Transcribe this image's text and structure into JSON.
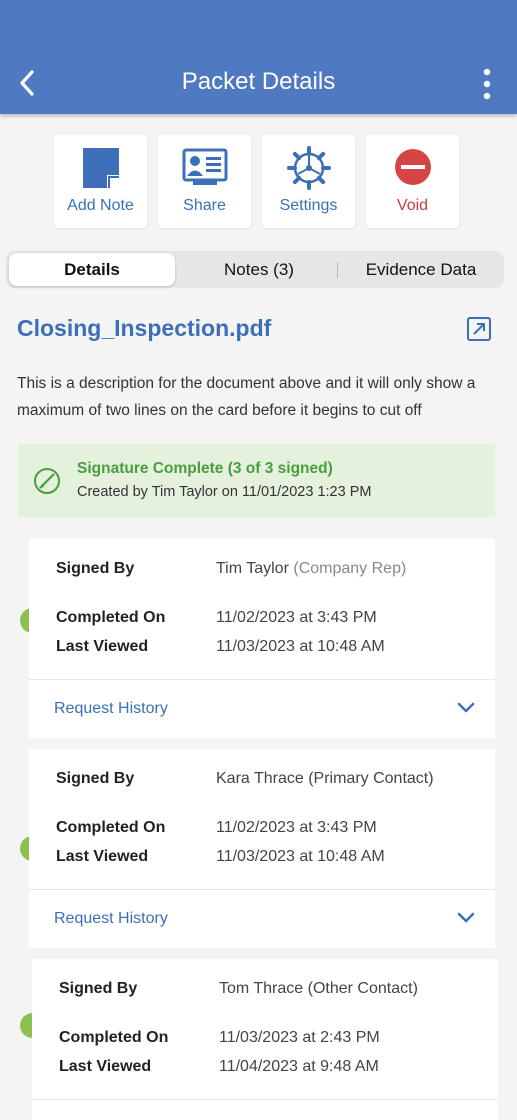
{
  "header": {
    "title": "Packet Details",
    "background": "#4f79c0"
  },
  "actions": [
    {
      "label": "Add Note",
      "icon": "note-icon"
    },
    {
      "label": "Share",
      "icon": "contact-card-icon"
    },
    {
      "label": "Settings",
      "icon": "gear-icon"
    },
    {
      "label": "Void",
      "icon": "no-entry-icon"
    }
  ],
  "tabs": [
    {
      "label": "Details",
      "active": true
    },
    {
      "label": "Notes (3)",
      "active": false
    },
    {
      "label": "Evidence Data",
      "active": false
    }
  ],
  "document": {
    "title": "Closing_Inspection.pdf",
    "description": "This is a description for the document above and it will only show a maximum of two lines on the card before it begins to cut off"
  },
  "status": {
    "title": "Signature Complete (3 of 3 signed)",
    "subtitle": "Created by Tim Taylor on 11/01/2023 1:23 PM",
    "color": "#4a9d3f"
  },
  "labels": {
    "signed_by": "Signed By",
    "completed_on": "Completed On",
    "last_viewed": "Last Viewed",
    "request_history": "Request History"
  },
  "signers": [
    {
      "name": "Tim Taylor",
      "role": "(Company Rep)",
      "completed": "11/02/2023 at 3:43 PM",
      "viewed": "11/03/2023 at 10:48 AM"
    },
    {
      "name": "Kara Thrace",
      "role": "(Primary Contact)",
      "completed": "11/02/2023 at 3:43 PM",
      "viewed": "11/03/2023 at 10:48 AM"
    },
    {
      "name": "Tom Thrace",
      "role": "(Other Contact)",
      "completed": "11/03/2023 at 2:43 PM",
      "viewed": "11/04/2023 at 9:48 AM"
    }
  ]
}
